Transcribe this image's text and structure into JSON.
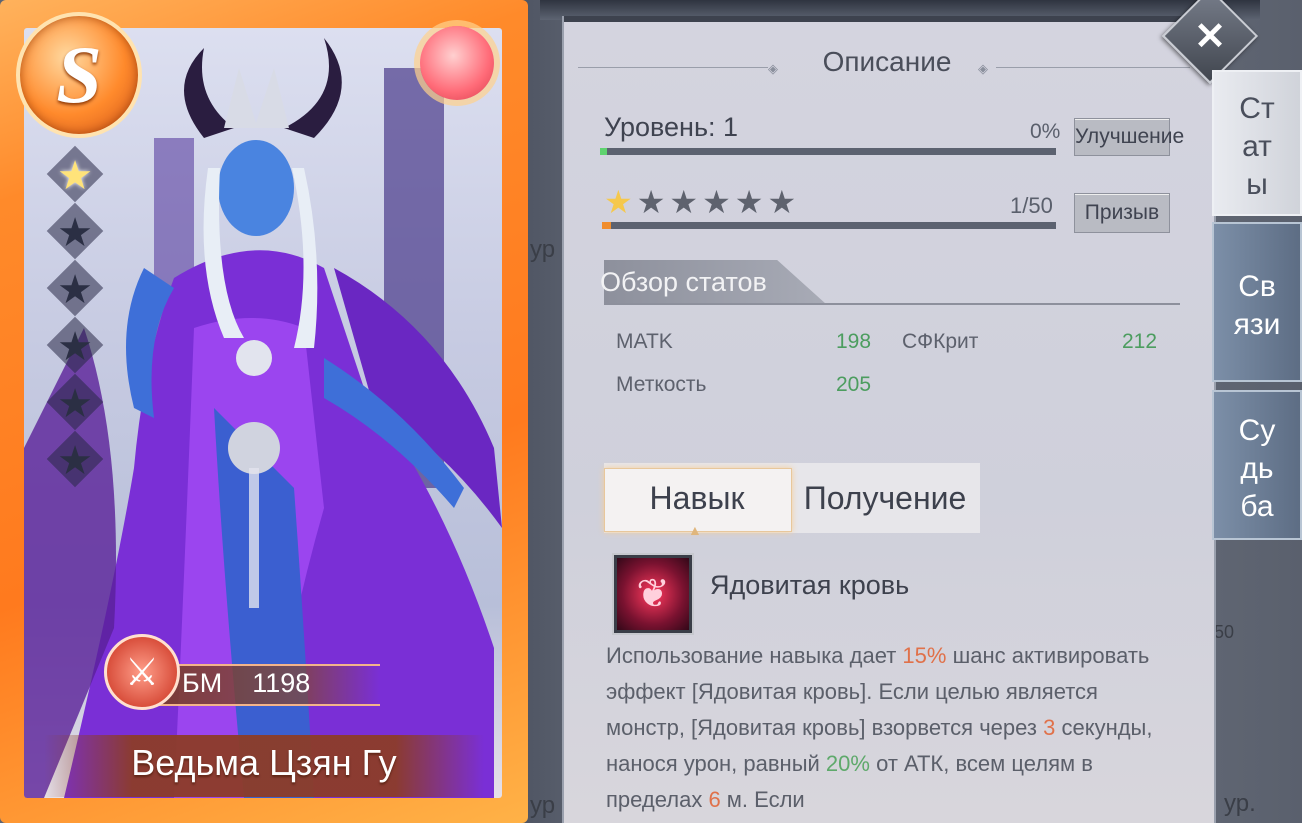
{
  "card": {
    "rank": "S",
    "stars_total": 6,
    "stars_filled": 1,
    "bm_label": "БМ",
    "bm_value": "1198",
    "hero_name": "Ведьма Цзян Гу"
  },
  "panel": {
    "title": "Описание",
    "close_icon": "close-icon",
    "level_label": "Уровень: 1",
    "level_progress_text": "0%",
    "level_progress": 0.0,
    "upgrade_button": "Улучшение",
    "stars_filled": 1,
    "stars_total": 6,
    "star_count_text": "1/50",
    "star_progress": 0.02,
    "summon_button": "Призыв",
    "stats_overview_title": "Обзор статов",
    "stats": [
      {
        "label": "MATK",
        "value": "198"
      },
      {
        "label": "СФКрит",
        "value": "212"
      },
      {
        "label": "Меткость",
        "value": "205"
      }
    ],
    "tabs": [
      {
        "label": "Навык",
        "active": true
      },
      {
        "label": "Получение",
        "active": false
      }
    ],
    "skill": {
      "name": "Ядовитая кровь",
      "desc_parts": {
        "p1": "Использование навыка дает ",
        "v1": "15%",
        "p2": " шанс активировать эффект [Ядовитая кровь]. Если целью является монстр, [Ядовитая кровь] взорвется через ",
        "v2": "3",
        "p3": " секунды, нанося урон, равный ",
        "v3": "20%",
        "p4": " от АТК, всем целям в пределах ",
        "v4": "6",
        "p5": " м. Если"
      }
    }
  },
  "side_tabs": [
    {
      "label": "Ст ат ы",
      "lines": [
        "Ст",
        "ат",
        "ы"
      ],
      "active": true
    },
    {
      "label": "Св язи",
      "lines": [
        "Св",
        "язи"
      ],
      "active": false
    },
    {
      "label": "Су дь ба",
      "lines": [
        "Су",
        "дь",
        "ба"
      ],
      "active": false
    }
  ],
  "background_fragments": [
    "ур",
    "50",
    "ур."
  ],
  "colors": {
    "card_frame": "#ff8a2a",
    "highlight_orange": "#e0714a",
    "highlight_green": "#5ea96b",
    "level_bar_fill": "#5fd36f",
    "star_bar_fill": "#f08d2d"
  }
}
